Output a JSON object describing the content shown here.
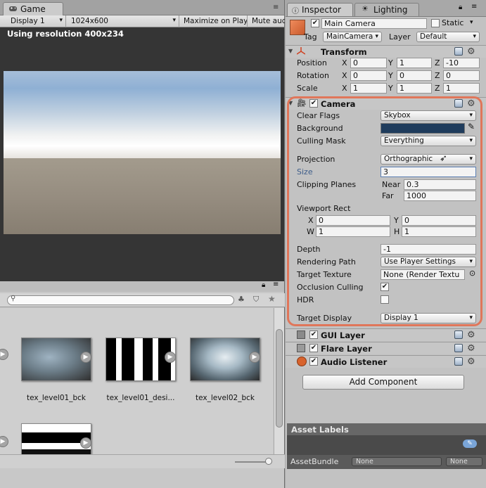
{
  "game": {
    "tab_label": "Game",
    "toolbar": {
      "display": "Display 1",
      "resolution": "1024x600",
      "maximize": "Maximize on Play",
      "mute": "Mute aud"
    },
    "resolution_note": "Using resolution 400x234"
  },
  "project": {
    "assets": [
      {
        "label": "tex_level01_bck"
      },
      {
        "label": "tex_level01_desi..."
      },
      {
        "label": "tex_level02_bck"
      }
    ]
  },
  "inspector": {
    "tabs": [
      {
        "label": "Inspector"
      },
      {
        "label": "Lighting"
      }
    ],
    "object": {
      "name": "Main Camera",
      "static_label": "Static",
      "tag_label": "Tag",
      "tag_value": "MainCamera",
      "layer_label": "Layer",
      "layer_value": "Default"
    },
    "transform": {
      "title": "Transform",
      "position_label": "Position",
      "rotation_label": "Rotation",
      "scale_label": "Scale",
      "axes": {
        "x": "X",
        "y": "Y",
        "z": "Z"
      },
      "position": {
        "x": "0",
        "y": "1",
        "z": "-10"
      },
      "rotation": {
        "x": "0",
        "y": "0",
        "z": "0"
      },
      "scale": {
        "x": "1",
        "y": "1",
        "z": "1"
      }
    },
    "camera": {
      "title": "Camera",
      "clear_flags_label": "Clear Flags",
      "clear_flags_value": "Skybox",
      "background_label": "Background",
      "background_color": "#1f3c5c",
      "culling_mask_label": "Culling Mask",
      "culling_mask_value": "Everything",
      "projection_label": "Projection",
      "projection_value": "Orthographic",
      "size_label": "Size",
      "size_value": "3",
      "clipping_label": "Clipping Planes",
      "near_label": "Near",
      "near_value": "0.3",
      "far_label": "Far",
      "far_value": "1000",
      "viewport_label": "Viewport Rect",
      "vx_label": "X",
      "vx_value": "0",
      "vy_label": "Y",
      "vy_value": "0",
      "vw_label": "W",
      "vw_value": "1",
      "vh_label": "H",
      "vh_value": "1",
      "depth_label": "Depth",
      "depth_value": "-1",
      "rendering_label": "Rendering Path",
      "rendering_value": "Use Player Settings",
      "target_texture_label": "Target Texture",
      "target_texture_value": "None (Render Textu",
      "occlusion_label": "Occlusion Culling",
      "occlusion_checked": true,
      "hdr_label": "HDR",
      "hdr_checked": false,
      "target_display_label": "Target Display",
      "target_display_value": "Display 1"
    },
    "components": [
      {
        "title": "GUI Layer"
      },
      {
        "title": "Flare Layer"
      },
      {
        "title": "Audio Listener"
      }
    ],
    "add_component": "Add Component",
    "asset_labels": "Asset Labels",
    "asset_bundle_label": "AssetBundle",
    "asset_bundle_value": "None",
    "asset_bundle_variant": "None",
    "highlight_color": "#e0765a"
  }
}
